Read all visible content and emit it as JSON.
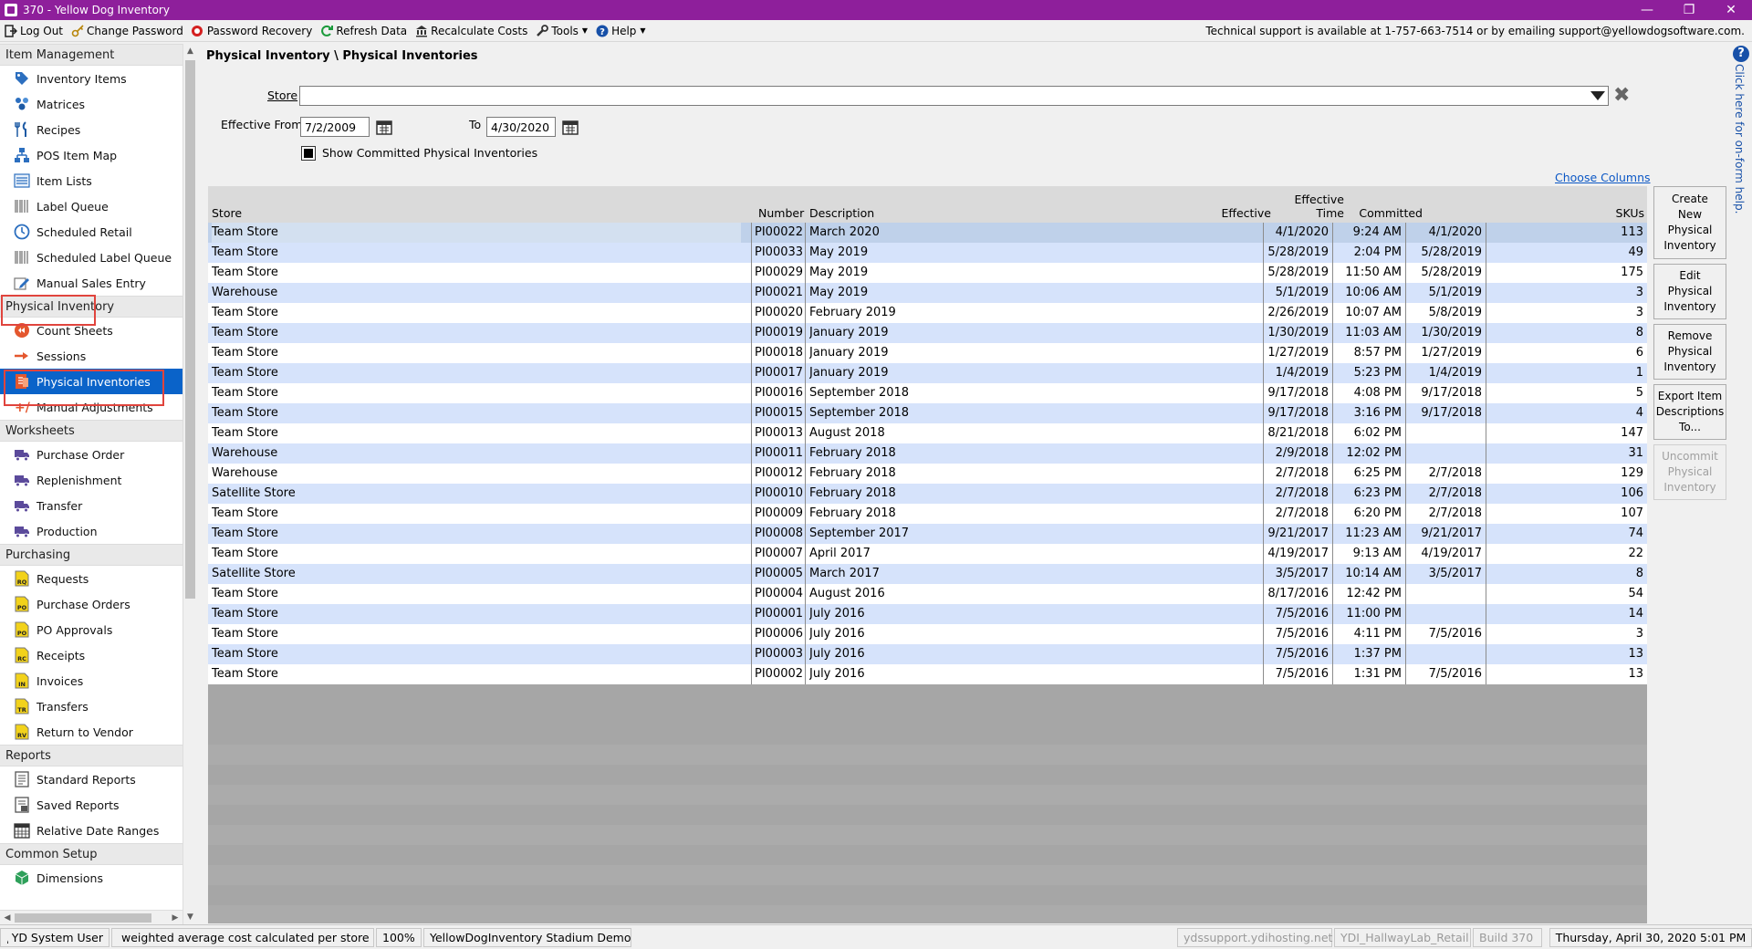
{
  "window": {
    "title": "370 - Yellow Dog Inventory"
  },
  "menubar": {
    "items": [
      "Log Out",
      "Change Password",
      "Password Recovery",
      "Refresh Data",
      "Recalculate Costs",
      "Tools",
      "Help"
    ],
    "support": "Technical support is available at 1-757-663-7514 or by emailing support@yellowdogsoftware.com."
  },
  "sidebar": {
    "groups": [
      {
        "label": "Item Management",
        "items": [
          {
            "label": "Inventory Items",
            "icon": "tag-icon"
          },
          {
            "label": "Matrices",
            "icon": "matrix-icon"
          },
          {
            "label": "Recipes",
            "icon": "fork-knife-icon"
          },
          {
            "label": "POS Item Map",
            "icon": "hierarchy-icon"
          },
          {
            "label": "Item Lists",
            "icon": "list-icon"
          },
          {
            "label": "Label Queue",
            "icon": "barcode-icon"
          },
          {
            "label": "Scheduled Retail",
            "icon": "clock-icon"
          },
          {
            "label": "Scheduled Label Queue",
            "icon": "barcode-icon"
          },
          {
            "label": "Manual Sales Entry",
            "icon": "pencil-icon"
          }
        ]
      },
      {
        "label": "Physical Inventory",
        "items": [
          {
            "label": "Count Sheets",
            "icon": "count-sheet-icon"
          },
          {
            "label": "Sessions",
            "icon": "session-icon"
          },
          {
            "label": "Physical Inventories",
            "icon": "physical-inventory-icon",
            "active": true
          },
          {
            "label": "Manual Adjustments",
            "icon": "plus-minus-icon"
          }
        ]
      },
      {
        "label": "Worksheets",
        "items": [
          {
            "label": "Purchase Order",
            "icon": "truck-icon"
          },
          {
            "label": "Replenishment",
            "icon": "truck-icon"
          },
          {
            "label": "Transfer",
            "icon": "truck-icon"
          },
          {
            "label": "Production",
            "icon": "truck-icon"
          }
        ]
      },
      {
        "label": "Purchasing",
        "items": [
          {
            "label": "Requests",
            "icon": "doc-rq-icon",
            "tag": "RQ"
          },
          {
            "label": "Purchase Orders",
            "icon": "doc-po-icon",
            "tag": "PO"
          },
          {
            "label": "PO Approvals",
            "icon": "doc-po-icon",
            "tag": "PO"
          },
          {
            "label": "Receipts",
            "icon": "doc-rc-icon",
            "tag": "RC"
          },
          {
            "label": "Invoices",
            "icon": "doc-in-icon",
            "tag": "IN"
          },
          {
            "label": "Transfers",
            "icon": "doc-tr-icon",
            "tag": "TR"
          },
          {
            "label": "Return to Vendor",
            "icon": "doc-rv-icon",
            "tag": "RV"
          }
        ]
      },
      {
        "label": "Reports",
        "items": [
          {
            "label": "Standard Reports",
            "icon": "report-icon"
          },
          {
            "label": "Saved Reports",
            "icon": "saved-report-icon"
          },
          {
            "label": "Relative Date Ranges",
            "icon": "calendar-icon"
          }
        ]
      },
      {
        "label": "Common Setup",
        "items": [
          {
            "label": "Dimensions",
            "icon": "cube-icon"
          }
        ]
      }
    ]
  },
  "main": {
    "breadcrumb": "Physical Inventory \\ Physical Inventories",
    "store_label": "Store",
    "effective_from_label": "Effective From",
    "effective_from": "7/2/2009",
    "to_label": "To",
    "to_date": "4/30/2020",
    "show_committed_label": "Show Committed Physical Inventories",
    "choose_columns": "Choose Columns",
    "columns": {
      "store": "Store",
      "number": "Number",
      "description": "Description",
      "effective": "Effective",
      "effective_time_1": "Effective",
      "effective_time_2": "Time",
      "committed": "Committed",
      "skus": "SKUs"
    },
    "rows": [
      {
        "store": "Team Store",
        "number": "PI00022",
        "description": "March 2020",
        "effective": "4/1/2020",
        "time": "9:24 AM",
        "committed": "4/1/2020",
        "skus": "113"
      },
      {
        "store": "Team Store",
        "number": "PI00033",
        "description": "May 2019",
        "effective": "5/28/2019",
        "time": "2:04 PM",
        "committed": "5/28/2019",
        "skus": "49"
      },
      {
        "store": "Team Store",
        "number": "PI00029",
        "description": "May 2019",
        "effective": "5/28/2019",
        "time": "11:50 AM",
        "committed": "5/28/2019",
        "skus": "175"
      },
      {
        "store": "Warehouse",
        "number": "PI00021",
        "description": "May 2019",
        "effective": "5/1/2019",
        "time": "10:06 AM",
        "committed": "5/1/2019",
        "skus": "3"
      },
      {
        "store": "Team Store",
        "number": "PI00020",
        "description": "February 2019",
        "effective": "2/26/2019",
        "time": "10:07 AM",
        "committed": "5/8/2019",
        "skus": "3"
      },
      {
        "store": "Team Store",
        "number": "PI00019",
        "description": "January 2019",
        "effective": "1/30/2019",
        "time": "11:03 AM",
        "committed": "1/30/2019",
        "skus": "8"
      },
      {
        "store": "Team Store",
        "number": "PI00018",
        "description": "January 2019",
        "effective": "1/27/2019",
        "time": "8:57 PM",
        "committed": "1/27/2019",
        "skus": "6"
      },
      {
        "store": "Team Store",
        "number": "PI00017",
        "description": "January 2019",
        "effective": "1/4/2019",
        "time": "5:23 PM",
        "committed": "1/4/2019",
        "skus": "1"
      },
      {
        "store": "Team Store",
        "number": "PI00016",
        "description": "September 2018",
        "effective": "9/17/2018",
        "time": "4:08 PM",
        "committed": "9/17/2018",
        "skus": "5"
      },
      {
        "store": "Team Store",
        "number": "PI00015",
        "description": "September 2018",
        "effective": "9/17/2018",
        "time": "3:16 PM",
        "committed": "9/17/2018",
        "skus": "4"
      },
      {
        "store": "Team Store",
        "number": "PI00013",
        "description": "August 2018",
        "effective": "8/21/2018",
        "time": "6:02 PM",
        "committed": "",
        "skus": "147"
      },
      {
        "store": "Warehouse",
        "number": "PI00011",
        "description": "February 2018",
        "effective": "2/9/2018",
        "time": "12:02 PM",
        "committed": "",
        "skus": "31"
      },
      {
        "store": "Warehouse",
        "number": "PI00012",
        "description": "February 2018",
        "effective": "2/7/2018",
        "time": "6:25 PM",
        "committed": "2/7/2018",
        "skus": "129"
      },
      {
        "store": "Satellite Store",
        "number": "PI00010",
        "description": "February 2018",
        "effective": "2/7/2018",
        "time": "6:23 PM",
        "committed": "2/7/2018",
        "skus": "106"
      },
      {
        "store": "Team Store",
        "number": "PI00009",
        "description": "February 2018",
        "effective": "2/7/2018",
        "time": "6:20 PM",
        "committed": "2/7/2018",
        "skus": "107"
      },
      {
        "store": "Team Store",
        "number": "PI00008",
        "description": "September 2017",
        "effective": "9/21/2017",
        "time": "11:23 AM",
        "committed": "9/21/2017",
        "skus": "74"
      },
      {
        "store": "Team Store",
        "number": "PI00007",
        "description": "April 2017",
        "effective": "4/19/2017",
        "time": "9:13 AM",
        "committed": "4/19/2017",
        "skus": "22"
      },
      {
        "store": "Satellite Store",
        "number": "PI00005",
        "description": "March 2017",
        "effective": "3/5/2017",
        "time": "10:14 AM",
        "committed": "3/5/2017",
        "skus": "8"
      },
      {
        "store": "Team Store",
        "number": "PI00004",
        "description": "August 2016",
        "effective": "8/17/2016",
        "time": "12:42 PM",
        "committed": "",
        "skus": "54"
      },
      {
        "store": "Team Store",
        "number": "PI00001",
        "description": "July 2016",
        "effective": "7/5/2016",
        "time": "11:00 PM",
        "committed": "",
        "skus": "14"
      },
      {
        "store": "Team Store",
        "number": "PI00006",
        "description": "July 2016",
        "effective": "7/5/2016",
        "time": "4:11 PM",
        "committed": "7/5/2016",
        "skus": "3"
      },
      {
        "store": "Team Store",
        "number": "PI00003",
        "description": "July 2016",
        "effective": "7/5/2016",
        "time": "1:37 PM",
        "committed": "",
        "skus": "13"
      },
      {
        "store": "Team Store",
        "number": "PI00002",
        "description": "July 2016",
        "effective": "7/5/2016",
        "time": "1:31 PM",
        "committed": "7/5/2016",
        "skus": "13"
      }
    ],
    "buttons": [
      {
        "lines": [
          "Create",
          "New",
          "Physical",
          "Inventory"
        ],
        "disabled": false
      },
      {
        "lines": [
          "Edit",
          "Physical",
          "Inventory"
        ],
        "disabled": false
      },
      {
        "lines": [
          "Remove",
          "Physical",
          "Inventory"
        ],
        "disabled": false
      },
      {
        "lines": [
          "Export Item",
          "Descriptions",
          "To..."
        ],
        "disabled": false
      },
      {
        "lines": [
          "Uncommit",
          "Physical",
          "Inventory"
        ],
        "disabled": true
      }
    ]
  },
  "help": {
    "vertical_text": "Click here for on-form help."
  },
  "status": {
    "user": "YD System User",
    "cost_mode": "weighted average cost calculated per store",
    "zoom": "100%",
    "database": "YellowDogInventory Stadium Demo",
    "server": "ydssupport.ydihosting.net",
    "instance": "YDI_HallwayLab_Retail",
    "build": "Build 370",
    "datetime": "Thursday, April 30, 2020 5:01 PM"
  }
}
